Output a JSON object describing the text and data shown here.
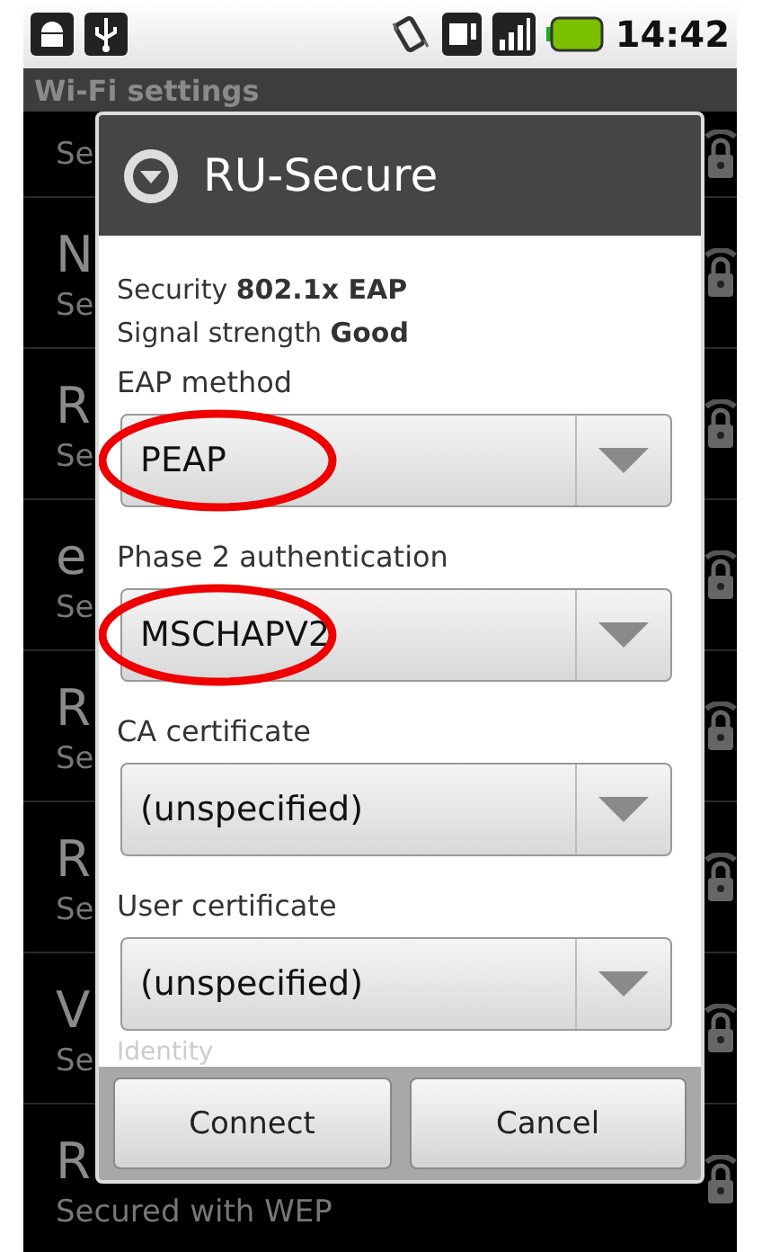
{
  "status_bar": {
    "time": "14:42"
  },
  "screen_title": "Wi-Fi settings",
  "networks": [
    {
      "subtitle": "Se"
    },
    {
      "name": "N",
      "subtitle": "Se"
    },
    {
      "name": "R",
      "subtitle": "Se"
    },
    {
      "name": "e",
      "subtitle": "Se"
    },
    {
      "name": "R",
      "subtitle": "Se"
    },
    {
      "name": "R",
      "subtitle": "Se"
    },
    {
      "name": "V",
      "subtitle": "Se"
    },
    {
      "name": "R",
      "subtitle": "Secured with WEP"
    }
  ],
  "dialog": {
    "title": "RU-Secure",
    "info": [
      {
        "label": "Security",
        "value": "802.1x EAP"
      },
      {
        "label": "Signal strength",
        "value": "Good"
      }
    ],
    "fields": [
      {
        "label": "EAP method",
        "value": "PEAP",
        "circled": true
      },
      {
        "label": "Phase 2 authentication",
        "value": "MSCHAPV2",
        "circled": true
      },
      {
        "label": "CA certificate",
        "value": "(unspecified)",
        "circled": false
      },
      {
        "label": "User certificate",
        "value": "(unspecified)",
        "circled": false
      }
    ],
    "next_label": "Identity",
    "buttons": [
      "Connect",
      "Cancel"
    ]
  }
}
